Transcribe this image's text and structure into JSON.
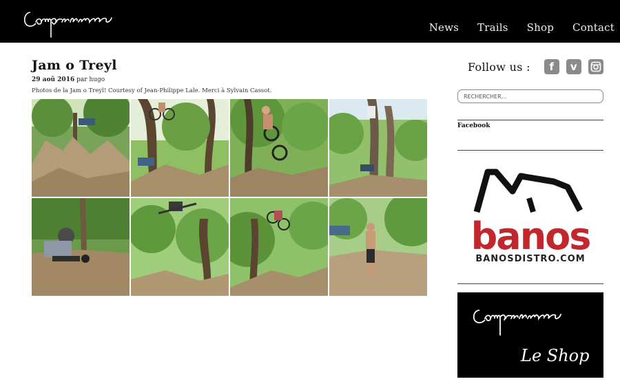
{
  "header": {
    "logo_text": "Compression",
    "nav": [
      "News",
      "Trails",
      "Shop",
      "Contact"
    ]
  },
  "post": {
    "title": "Jam o Treyl",
    "date": "29 aoû 2016",
    "by": "par",
    "author": "hugo",
    "excerpt": "Photos de la Jam o Treyl! Courtesy of Jean-Philippe Lale. Merci à Sylvain Cassot."
  },
  "sidebar": {
    "follow_label": "Follow us :",
    "social_icons": [
      "facebook-icon",
      "vimeo-icon",
      "instagram-icon"
    ],
    "search_placeholder": "RECHERCHER...",
    "facebook_widget_title": "Facebook",
    "banos_banner": {
      "word": "banos",
      "site": "BANOSDISTRO.COM"
    },
    "shop_banner": {
      "logo_text": "Compression",
      "caption": "Le Shop"
    }
  },
  "colors": {
    "header_bg": "#000000",
    "banos_red": "#c0282d"
  }
}
